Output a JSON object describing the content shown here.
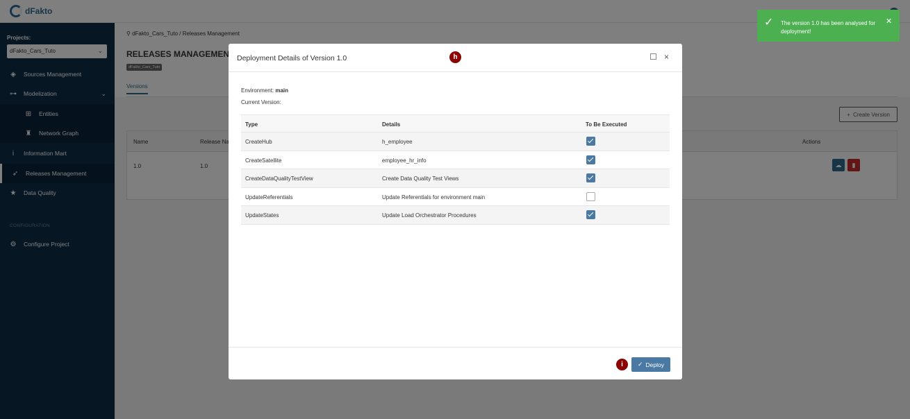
{
  "app": {
    "logo_text": "dFakto"
  },
  "sidebar": {
    "projects_label": "Projects:",
    "project_selected": "dFakto_Cars_Tuto",
    "items": [
      {
        "label": "Sources Management",
        "icon": "layers-icon"
      },
      {
        "label": "Modelization",
        "icon": "sitemap-icon"
      },
      {
        "label": "Entities",
        "icon": "hierarchy-icon"
      },
      {
        "label": "Network Graph",
        "icon": "binoculars-icon"
      },
      {
        "label": "Information Mart",
        "icon": "info-icon"
      },
      {
        "label": "Releases Management",
        "icon": "rocket-icon"
      },
      {
        "label": "Data Quality",
        "icon": "star-icon"
      }
    ],
    "config_label": "CONFIGURATION",
    "config_item": "Configure Project"
  },
  "main": {
    "breadcrumb": "dFakto_Cars_Tuto  /  Releases Management",
    "title": "RELEASES MANAGEMENT",
    "project_tag": "dFakto_Cars_Tuto",
    "tab": "Versions",
    "create_button": "Create Version",
    "table": {
      "headers": [
        "Name",
        "Release Na",
        "Actions"
      ],
      "row": [
        "1.0",
        "1.0"
      ]
    }
  },
  "modal": {
    "title": "Deployment Details of Version 1.0",
    "marker_h": "h",
    "marker_i": "i",
    "env_label": "Environment: ",
    "env_value": "main",
    "current_version_label": "Current Version:",
    "headers": {
      "type": "Type",
      "details": "Details",
      "exec": "To Be Executed"
    },
    "rows": [
      {
        "type": "CreateHub",
        "details": "h_employee",
        "checked": true
      },
      {
        "type": "CreateSatellite",
        "details": "employee_hr_info",
        "checked": true
      },
      {
        "type": "CreateDataQualityTestView",
        "details": "Create Data Quality Test Views",
        "checked": true
      },
      {
        "type": "UpdateReferentials",
        "details": "Update Referentials for environment main",
        "checked": false
      },
      {
        "type": "UpdateStates",
        "details": "Update Load Orchestrator Procedures",
        "checked": true
      }
    ],
    "deploy_label": "Deploy"
  },
  "toast": {
    "message": "The version 1.0 has been analysed for deployment!"
  }
}
